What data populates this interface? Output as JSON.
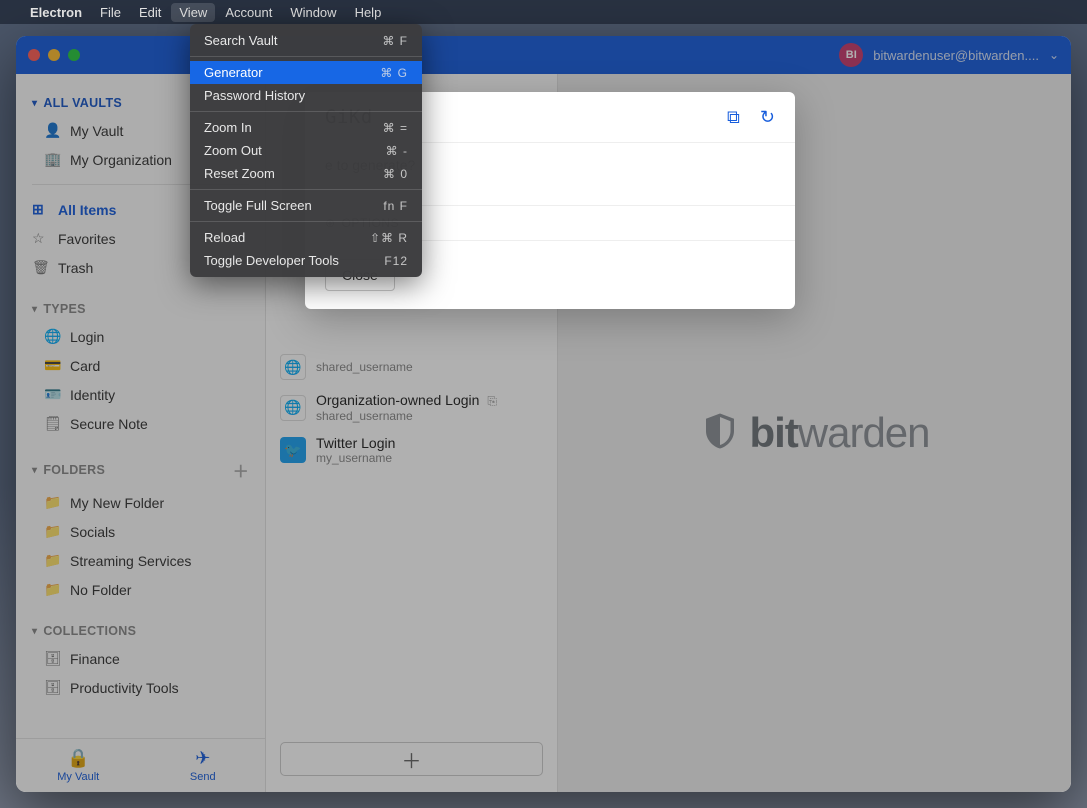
{
  "menubar": {
    "app": "Electron",
    "items": [
      "File",
      "Edit",
      "View",
      "Account",
      "Window",
      "Help"
    ],
    "active": "View"
  },
  "dropdown": {
    "items": [
      {
        "label": "Search Vault",
        "shortcut": "⌘ F",
        "highlight": false
      },
      {
        "sep": true
      },
      {
        "label": "Generator",
        "shortcut": "⌘ G",
        "highlight": true
      },
      {
        "label": "Password History",
        "shortcut": "",
        "highlight": false
      },
      {
        "sep": true
      },
      {
        "label": "Zoom In",
        "shortcut": "⌘ =",
        "highlight": false
      },
      {
        "label": "Zoom Out",
        "shortcut": "⌘ -",
        "highlight": false
      },
      {
        "label": "Reset Zoom",
        "shortcut": "⌘ 0",
        "highlight": false
      },
      {
        "sep": true
      },
      {
        "label": "Toggle Full Screen",
        "shortcut": "fn F",
        "highlight": false
      },
      {
        "sep": true
      },
      {
        "label": "Reload",
        "shortcut": "⇧⌘ R",
        "highlight": false
      },
      {
        "label": "Toggle Developer Tools",
        "shortcut": "F12",
        "highlight": false
      }
    ]
  },
  "titlebar": {
    "avatar_initials": "BI",
    "account_email": "bitwardenuser@bitwarden...."
  },
  "sidebar": {
    "all_vaults": "ALL VAULTS",
    "vaults": [
      {
        "icon": "person",
        "label": "My Vault"
      },
      {
        "icon": "org",
        "label": "My Organization"
      }
    ],
    "all_items": "All Items",
    "filters": [
      {
        "icon": "star",
        "label": "Favorites"
      },
      {
        "icon": "trash",
        "label": "Trash"
      }
    ],
    "types_header": "TYPES",
    "types": [
      {
        "icon": "globe",
        "label": "Login"
      },
      {
        "icon": "card",
        "label": "Card"
      },
      {
        "icon": "id",
        "label": "Identity"
      },
      {
        "icon": "note",
        "label": "Secure Note"
      }
    ],
    "folders_header": "FOLDERS",
    "folders": [
      {
        "label": "My New Folder"
      },
      {
        "label": "Socials"
      },
      {
        "label": "Streaming Services"
      },
      {
        "label": "No Folder"
      }
    ],
    "collections_header": "COLLECTIONS",
    "collections": [
      {
        "label": "Finance"
      },
      {
        "label": "Productivity Tools"
      }
    ],
    "bottom": {
      "vault": "My Vault",
      "send": "Send"
    }
  },
  "list": {
    "rows": [
      {
        "icon": "globe",
        "title": "",
        "sub": "shared_username"
      },
      {
        "icon": "globe",
        "title": "Organization-owned Login",
        "sub": "shared_username",
        "shared": true
      },
      {
        "icon": "twitter",
        "title": "Twitter Login",
        "sub": "my_username"
      }
    ]
  },
  "modal": {
    "generated_fragment": "GiKd",
    "question_fragment": "e to generate?",
    "options_label": "OPTIONS",
    "close": "Close"
  },
  "logo": {
    "bold": "bit",
    "rest": "warden"
  }
}
